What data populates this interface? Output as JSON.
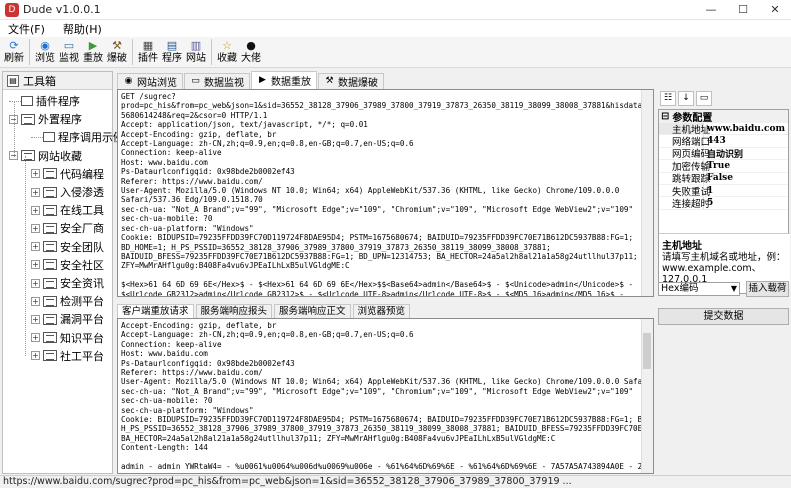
{
  "window": {
    "title": "Dude v1.0.0.1",
    "min": "—",
    "max": "☐",
    "close": "✕"
  },
  "menu": [
    "文件(F)",
    "帮助(H)"
  ],
  "toolbar": [
    {
      "label": "刷新",
      "icon": "refresh-icon",
      "glyph": "⟳",
      "color": "#2a7ad5"
    },
    {
      "label": "浏览",
      "icon": "browser-icon",
      "glyph": "◉",
      "color": "#1e6fd1"
    },
    {
      "label": "监视",
      "icon": "monitor-icon",
      "glyph": "▭",
      "color": "#2f6f9f"
    },
    {
      "label": "重放",
      "icon": "replay-icon",
      "glyph": "▶",
      "color": "#3a9a3a"
    },
    {
      "label": "爆破",
      "icon": "hammer-icon",
      "glyph": "⚒",
      "color": "#7a5a2a"
    },
    {
      "label": "插件",
      "icon": "plugin-icon",
      "glyph": "▦",
      "color": "#444"
    },
    {
      "label": "程序",
      "icon": "program-icon",
      "glyph": "▤",
      "color": "#2a5a9a"
    },
    {
      "label": "网站",
      "icon": "website-icon",
      "glyph": "▥",
      "color": "#5a5aa0"
    },
    {
      "label": "收藏",
      "icon": "star-icon",
      "glyph": "☆",
      "color": "#c59a10"
    },
    {
      "label": "大佬",
      "icon": "github-icon",
      "glyph": "●",
      "color": "#111"
    }
  ],
  "left": {
    "header": "工具箱",
    "tree": [
      {
        "label": "插件程序",
        "level": 0,
        "kind": "leaf"
      },
      {
        "label": "外置程序",
        "level": 0,
        "kind": "folder",
        "expander": "−"
      },
      {
        "label": "程序调用示例",
        "level": 1,
        "kind": "leaf"
      },
      {
        "label": "网站收藏",
        "level": 0,
        "kind": "folder",
        "expander": "−"
      },
      {
        "label": "代码编程",
        "level": 1,
        "kind": "folder",
        "expander": "+"
      },
      {
        "label": "入侵渗透",
        "level": 1,
        "kind": "folder",
        "expander": "+"
      },
      {
        "label": "在线工具",
        "level": 1,
        "kind": "folder",
        "expander": "+"
      },
      {
        "label": "安全厂商",
        "level": 1,
        "kind": "folder",
        "expander": "+"
      },
      {
        "label": "安全团队",
        "level": 1,
        "kind": "folder",
        "expander": "+"
      },
      {
        "label": "安全社区",
        "level": 1,
        "kind": "folder",
        "expander": "+"
      },
      {
        "label": "安全资讯",
        "level": 1,
        "kind": "folder",
        "expander": "+"
      },
      {
        "label": "检测平台",
        "level": 1,
        "kind": "folder",
        "expander": "+"
      },
      {
        "label": "漏洞平台",
        "level": 1,
        "kind": "folder",
        "expander": "+"
      },
      {
        "label": "知识平台",
        "level": 1,
        "kind": "folder",
        "expander": "+"
      },
      {
        "label": "社工平台",
        "level": 1,
        "kind": "folder",
        "expander": "+"
      }
    ]
  },
  "tabs": [
    {
      "label": "网站浏览",
      "icon": "browser-icon",
      "glyph": "◉",
      "active": false
    },
    {
      "label": "数据监视",
      "icon": "monitor-icon",
      "glyph": "▭",
      "active": false
    },
    {
      "label": "数据重放",
      "icon": "replay-icon",
      "glyph": "▶",
      "active": true
    },
    {
      "label": "数据爆破",
      "icon": "hammer-icon",
      "glyph": "⚒",
      "active": false
    }
  ],
  "request": "GET /sugrec?\nprod=pc_his&from=pc_web&json=1&sid=36552_38128_37906_37989_37800_37919_37873_26350_38119_38099_38008_37881&hisdata=&_t=167\n5680614248&req=2&csor=0 HTTP/1.1\nAccept: application/json, text/javascript, */*; q=0.01\nAccept-Encoding: gzip, deflate, br\nAccept-Language: zh-CN,zh;q=0.9,en;q=0.8,en-GB;q=0.7,en-US;q=0.6\nConnection: keep-alive\nHost: www.baidu.com\nPs-Dataurlconfigqid: 0x98bde2b0002ef43\nReferer: https://www.baidu.com/\nUser-Agent: Mozilla/5.0 (Windows NT 10.0; Win64; x64) AppleWebKit/537.36 (KHTML, like Gecko) Chrome/109.0.0.0\nSafari/537.36 Edg/109.0.1518.70\nsec-ch-ua: \"Not_A Brand\";v=\"99\", \"Microsoft Edge\";v=\"109\", \"Chromium\";v=\"109\", \"Microsoft Edge WebView2\";v=\"109\"\nsec-ch-ua-mobile: ?0\nsec-ch-ua-platform: \"Windows\"\nCookie: BIDUPSID=79235FFDD39FC70D119724F8DAE95D4; PSTM=1675680674; BAIDUID=79235FFDD39FC70E71B612DC5937B88:FG=1;\nBD_HOME=1; H_PS_PSSID=36552_38128_37906_37989_37800_37919_37873_26350_38119_38099_38008_37881;\nBAIDUID_BFESS=79235FFDD39FC70E71B612DC5937B88:FG=1; BD_UPN=12314753; BA_HECTOR=24a5al2h8al21a1a58g24utllhul37p11;\nZFY=MwMrAHflgu0g:B408Fa4vu6vJPEaILhLxB5ulVGldgME:C\n\n$<Hex>61 64 6D 69 6E</Hex>$ - $<Hex>61 64 6D 69 6E</Hex>$$<Base64>admin</Base64>$ - $<Unicode>admin</Unicode>$ -\n$<Urlcode_GB2312>admin</Urlcode_GB2312>$ - $<Urlcode_UTF-8>admin</Urlcode_UTF-8>$ - $<MD5_16>admin</MD5_16>$ -\n$<MD5_32>admin</MD5_32>$",
  "subtabs": [
    {
      "label": "客户端重放请求",
      "active": true
    },
    {
      "label": "服务端响应报头",
      "active": false
    },
    {
      "label": "服务端响应正文",
      "active": false
    },
    {
      "label": "浏览器预览",
      "active": false
    }
  ],
  "response": "Accept-Encoding: gzip, deflate, br\nAccept-Language: zh-CN,zh;q=0.9,en;q=0.8,en-GB;q=0.7,en-US;q=0.6\nConnection: keep-alive\nHost: www.baidu.com\nPs-Dataurlconfigqid: 0x98bde2b0002ef43\nReferer: https://www.baidu.com/\nUser-Agent: Mozilla/5.0 (Windows NT 10.0; Win64; x64) AppleWebKit/537.36 (KHTML, like Gecko) Chrome/109.0.0.0 Safari/537.36 Edg/109.0.1518.70\nsec-ch-ua: \"Not_A Brand\";v=\"99\", \"Microsoft Edge\";v=\"109\", \"Chromium\";v=\"109\", \"Microsoft Edge WebView2\";v=\"109\"\nsec-ch-ua-mobile: ?0\nsec-ch-ua-platform: \"Windows\"\nCookie: BIDUPSID=79235FFDD39FC70D119724F8DAE95D4; PSTM=1675680674; BAIDUID=79235FFDD39FC70E71B612DC5937B88:FG=1; BD_HOME=1;\nH_PS_PSSID=36552_38128_37906_37989_37800_37919_37873_26350_38119_38099_38008_37881; BAIDUID_BFESS=79235FFDD39FC70E71B612DC5937B88:FG=1; BD_UPN=12314753;\nBA_HECTOR=24a5al2h8al21a1a58g24utllhul37p11; ZFY=MwMrAHflgu0g:B408Fa4vu6vJPEaILhLxB5ulVGldgME:C\nContent-Length: 144\n\nadmin - admin YWRtaW4= - %u0061%u0064%u006d%u0069%u006e - %61%64%6D%69%6E - %61%64%6D%69%6E - 7A57A5A743894A0E - 21232F297A57A5A743894A0E4A801FC3",
  "props": {
    "category": "参数配置",
    "rows": [
      {
        "k": "主机地址",
        "v": "www.baidu.com",
        "sel": true
      },
      {
        "k": "网络端口",
        "v": "443"
      },
      {
        "k": "网页编码",
        "v": "自动识别"
      },
      {
        "k": "加密传输",
        "v": "True"
      },
      {
        "k": "跳转跟踪",
        "v": "False"
      },
      {
        "k": "失败重试",
        "v": "1"
      },
      {
        "k": "连接超时",
        "v": "5"
      }
    ],
    "desc_title": "主机地址",
    "desc_text": "请填写主机域名或地址，例：www.example.com、127.0.0.1"
  },
  "encoding": {
    "selected": "Hex编码"
  },
  "insert_button": "插入载荷",
  "submit_button": "提交数据",
  "status": "https://www.baidu.com/sugrec?prod=pc_his&from=pc_web&json=1&sid=36552_38128_37906_37989_37800_37919 ..."
}
